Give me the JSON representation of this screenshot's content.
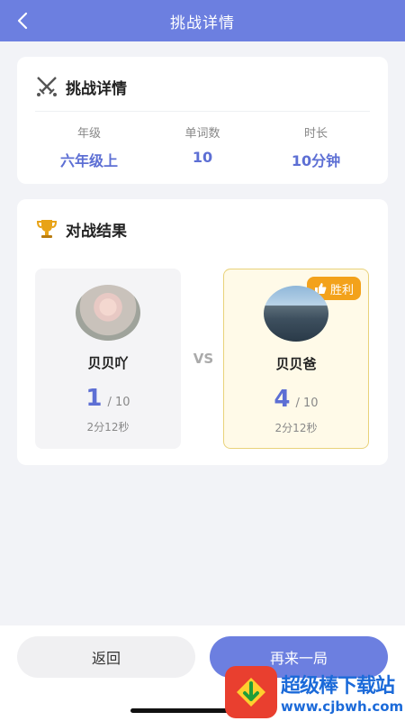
{
  "header": {
    "title": "挑战详情",
    "back_icon": "chevron-left-icon"
  },
  "details_card": {
    "title": "挑战详情",
    "icon": "crossed-swords-icon",
    "stats": [
      {
        "label": "年级",
        "value": "六年级上"
      },
      {
        "label": "单词数",
        "value": "10"
      },
      {
        "label": "时长",
        "value": "10分钟"
      }
    ]
  },
  "result_card": {
    "title": "对战结果",
    "icon": "trophy-icon",
    "vs": "VS",
    "players": [
      {
        "name": "贝贝吖",
        "score": "1",
        "total": "/ 10",
        "time": "2分12秒",
        "winner": false
      },
      {
        "name": "贝贝爸",
        "score": "4",
        "total": "/ 10",
        "time": "2分12秒",
        "winner": true,
        "badge": "胜利"
      }
    ]
  },
  "buttons": {
    "back": "返回",
    "again": "再来一局"
  },
  "watermark": {
    "title": "超级棒下载站",
    "url": "www.cjbwh.com"
  },
  "colors": {
    "primary": "#6c7fe0",
    "accent_text": "#5d6fd4",
    "win_badge": "#f3a21b"
  }
}
